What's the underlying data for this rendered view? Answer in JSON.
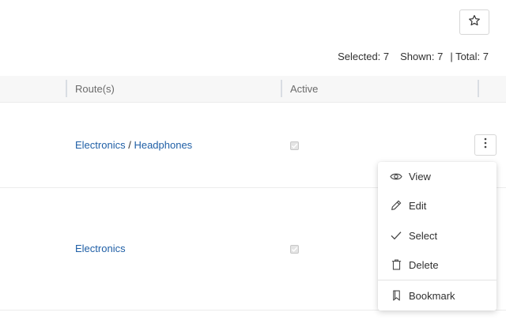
{
  "toolbar": {
    "favorite_icon": "star-outline-icon"
  },
  "counts": {
    "selected": "Selected: 7",
    "shown": "Shown: 7",
    "total": "| Total: 7"
  },
  "table": {
    "columns": [
      {
        "label": "Route(s)"
      },
      {
        "label": "Active"
      }
    ],
    "rows": [
      {
        "route_parts": [
          "Electronics",
          "Headphones"
        ],
        "separator": "/",
        "active": true
      },
      {
        "route_parts": [
          "Electronics"
        ],
        "active": true
      }
    ]
  },
  "row_menu": {
    "items": [
      {
        "label": "View",
        "icon": "eye-icon"
      },
      {
        "label": "Edit",
        "icon": "pencil-icon"
      },
      {
        "label": "Select",
        "icon": "check-icon"
      },
      {
        "label": "Delete",
        "icon": "trash-icon"
      },
      {
        "label": "Bookmark",
        "icon": "bookmark-icon"
      }
    ]
  },
  "colors": {
    "link": "#1f5fa6",
    "header_bg": "#f7f7f7",
    "text": "#303030"
  }
}
